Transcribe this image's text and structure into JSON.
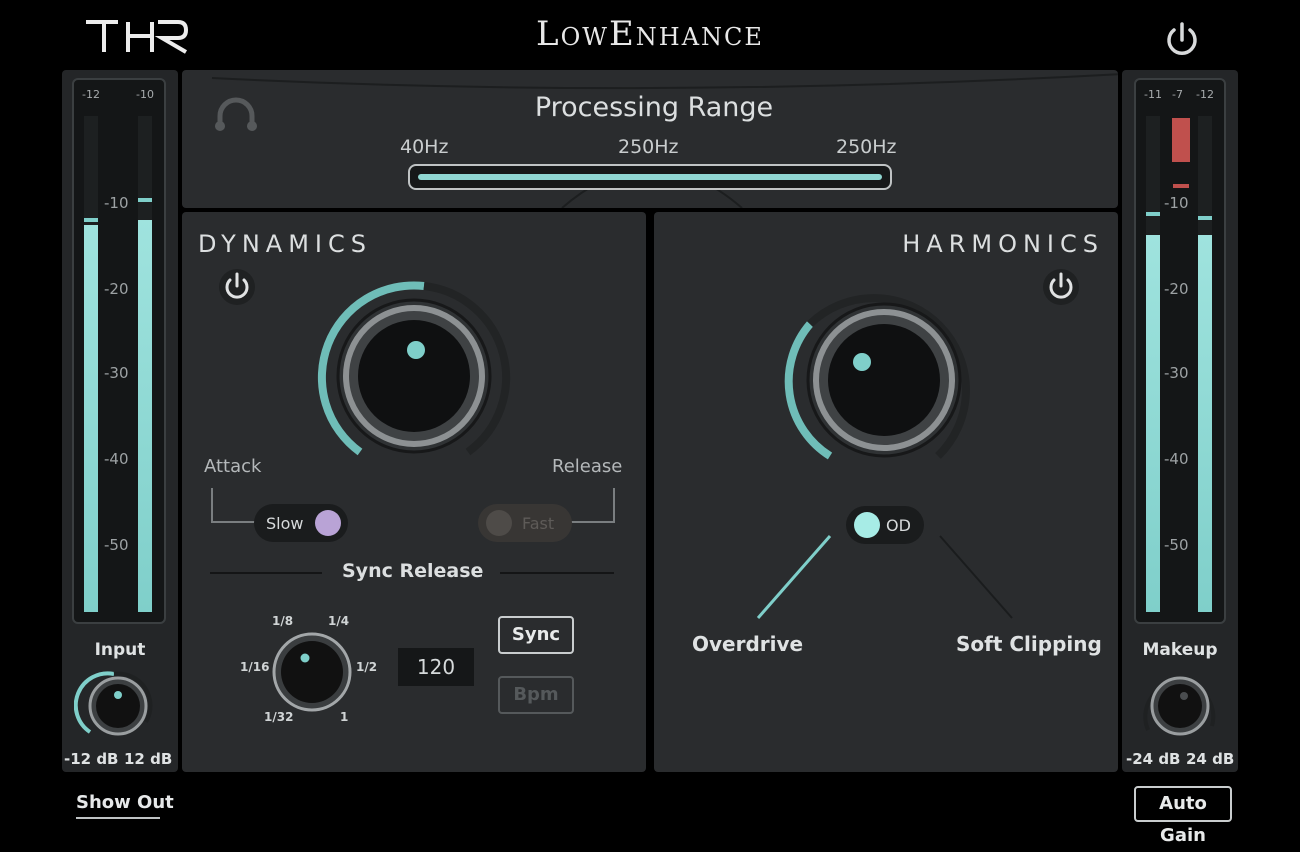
{
  "header": {
    "logo_text": "THR",
    "title": "LowEnhance"
  },
  "input_meter": {
    "scale": [
      "-10",
      "-20",
      "-30",
      "-40",
      "-50"
    ],
    "peak_left": "-12",
    "peak_right": "-10",
    "level_left": 0.78,
    "level_right": 0.79
  },
  "output_meter": {
    "scale": [
      "-10",
      "-20",
      "-30",
      "-40",
      "-50"
    ],
    "peak_left": "-11",
    "peak_mid": "-7",
    "peak_right": "-12",
    "level_left": 0.76,
    "level_right": 0.76
  },
  "input_knob": {
    "label": "Input",
    "min_label": "-12 dB",
    "max_label": "12 dB"
  },
  "makeup_knob": {
    "label": "Makeup",
    "min_label": "-24 dB",
    "max_label": "24 dB"
  },
  "processing": {
    "title": "Processing Range",
    "low_label": "40Hz",
    "mid_label": "250Hz",
    "high_label": "250Hz"
  },
  "dynamics": {
    "title": "DYNAMICS",
    "attack_label": "Attack",
    "release_label": "Release",
    "attack_toggle": "Slow",
    "release_toggle": "Fast",
    "sync_release_label": "Sync Release",
    "rate_labels": {
      "r1_8": "1/8",
      "r1_4": "1/4",
      "r1_16": "1/16",
      "r1_2": "1/2",
      "r1_32": "1/32",
      "r1": "1"
    },
    "bpm_value": "120",
    "sync_button": "Sync",
    "bpm_button": "Bpm"
  },
  "harmonics": {
    "title": "HARMONICS",
    "mode_toggle": "OD",
    "overdrive_label": "Overdrive",
    "soft_clipping_label": "Soft Clipping"
  },
  "footer": {
    "show_out": "Show Out",
    "auto_gain": "Auto Gain"
  },
  "colors": {
    "accent": "#7fcfca",
    "meter_peak": "#c0504d",
    "toggle_slow": "#b9a3d6",
    "panel": "#2a2c2e"
  }
}
